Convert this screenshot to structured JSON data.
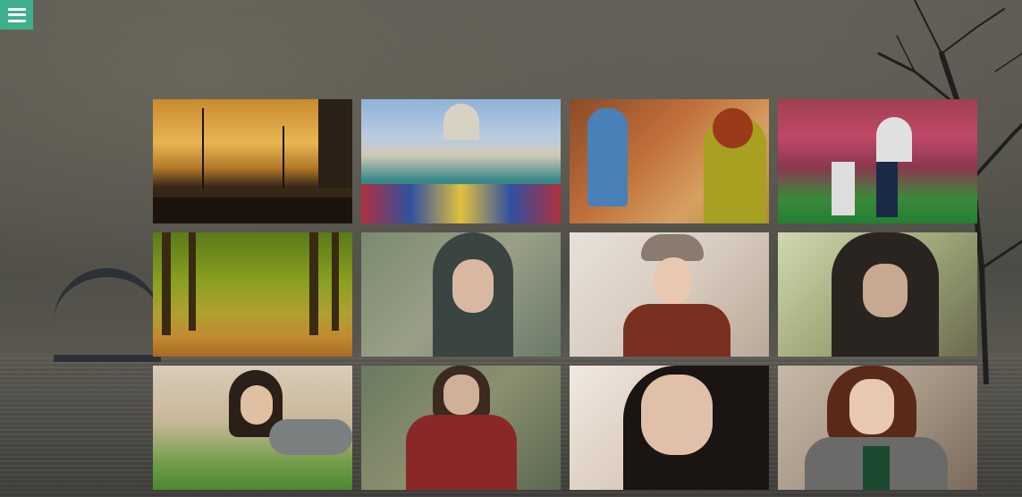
{
  "menu": {
    "icon": "hamburger-menu-icon"
  },
  "colors": {
    "accent": "#3fb08c",
    "background": "#4a4a45"
  },
  "gallery": {
    "photos": [
      {
        "name": "sunset-pier-photo"
      },
      {
        "name": "city-bridge-crowd-photo"
      },
      {
        "name": "street-art-women-photo"
      },
      {
        "name": "graffiti-market-photo"
      },
      {
        "name": "tree-avenue-photo"
      },
      {
        "name": "hooded-woman-photo"
      },
      {
        "name": "woman-in-hat-photo"
      },
      {
        "name": "woman-dark-hair-photo"
      },
      {
        "name": "woman-in-grass-photo"
      },
      {
        "name": "woman-red-coat-photo"
      },
      {
        "name": "woman-close-up-photo"
      },
      {
        "name": "woman-grey-cardigan-photo"
      }
    ]
  }
}
